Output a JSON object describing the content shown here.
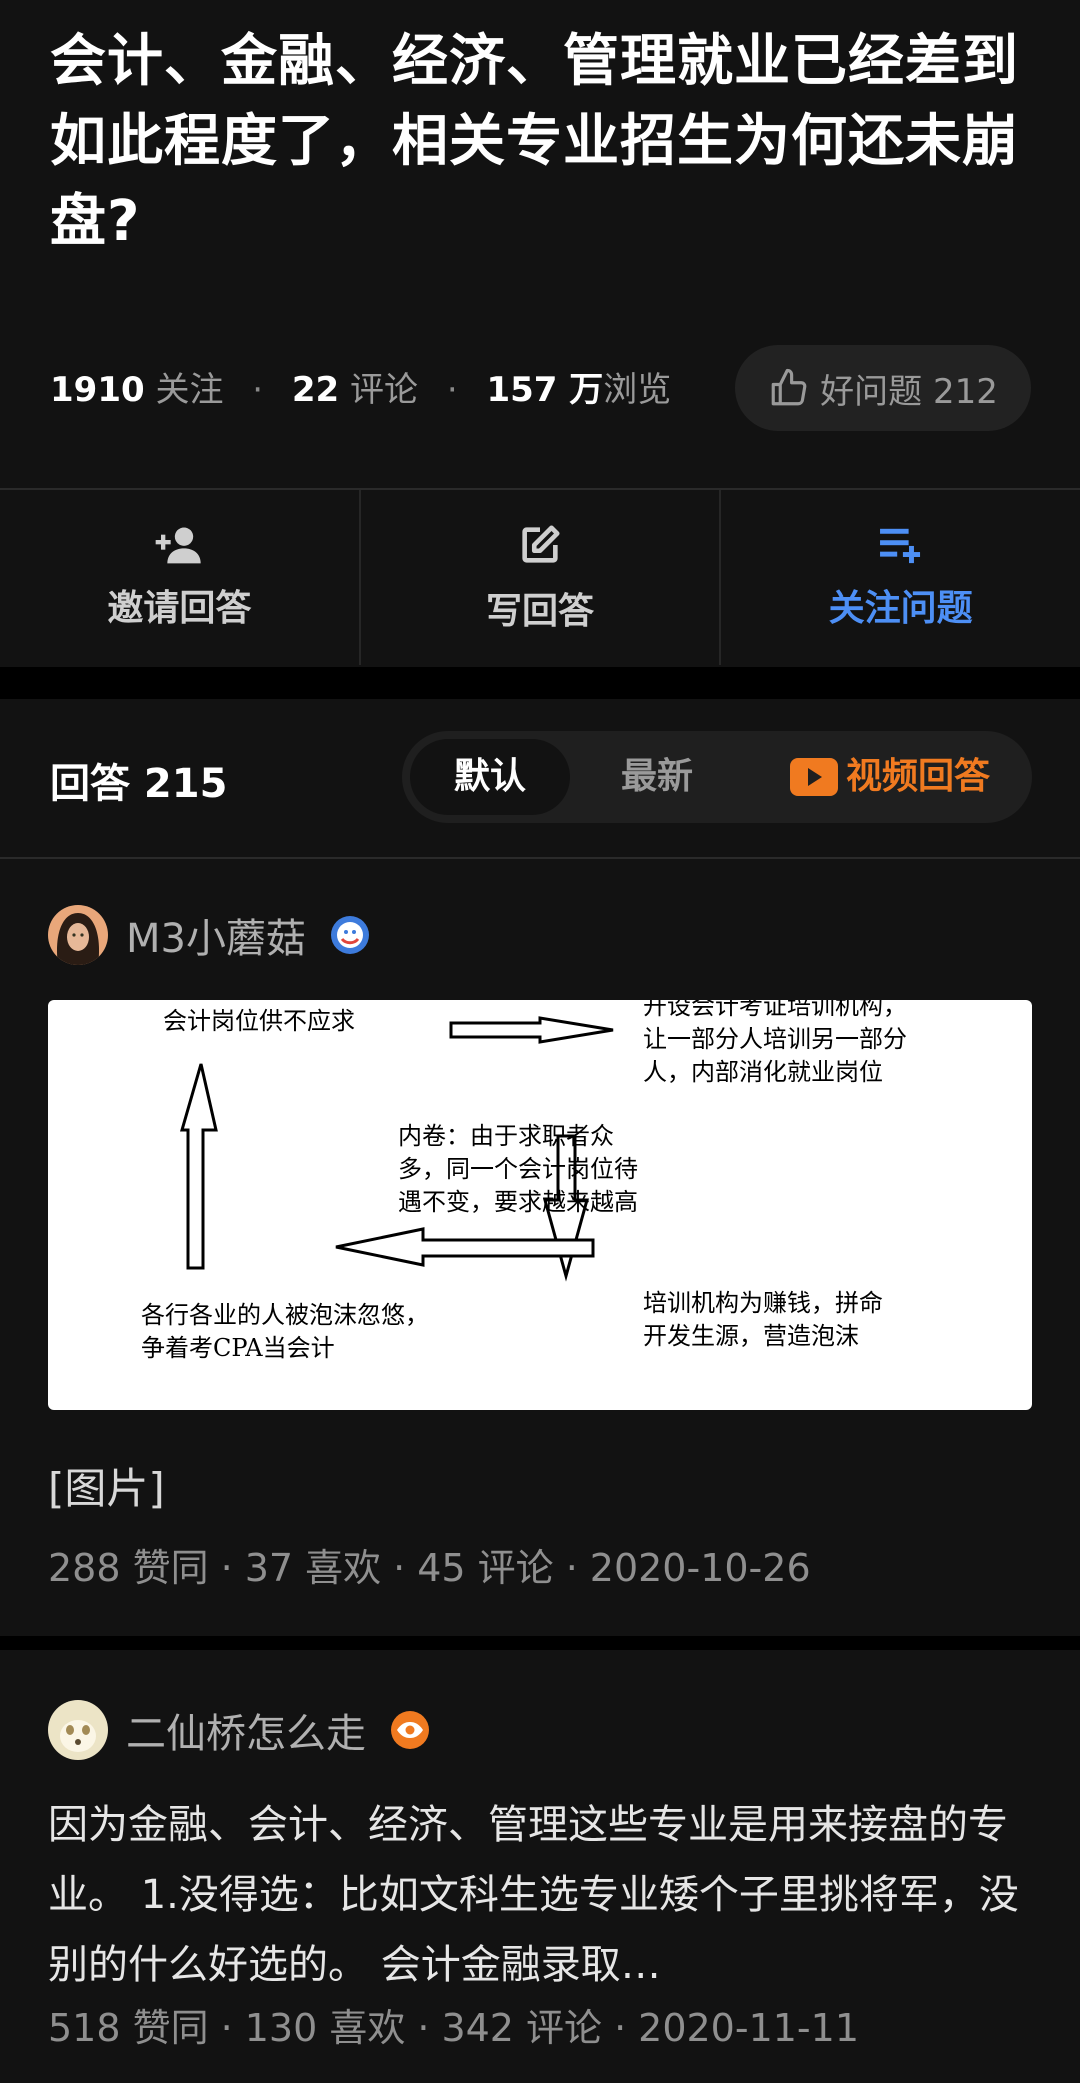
{
  "question": {
    "title": "会计、金融、经济、管理就业已经差到如此程度了，相关专业招生为何还未崩盘?",
    "follow_count": "1910",
    "follow_label": "关注",
    "comment_count": "22",
    "comment_label": "评论",
    "view_count": "157 万",
    "view_label": "浏览",
    "good_question_label": "好问题 212"
  },
  "actions": {
    "invite": "邀请回答",
    "write": "写回答",
    "follow": "关注问题"
  },
  "answers_header": {
    "count_label": "回答 215",
    "tabs": [
      "默认",
      "最新",
      "视频回答"
    ],
    "selected_tab": "默认"
  },
  "answer1": {
    "author": "M3小蘑菇",
    "diagram": {
      "top_left": "会计岗位供不应求",
      "top_right": "开设会计考证培训机构，让一部分人培训另一部分人，内部消化就业岗位",
      "center": "内卷：由于求职者众多，同一个会计岗位待遇不变，要求越来越高",
      "bottom_right": "培训机构为赚钱，拼命开发生源，营造泡沫",
      "bottom_left": "各行各业的人被泡沫忽悠，争着考CPA当会计"
    },
    "image_caption": "[图片]",
    "upvotes": "288 赞同",
    "likes": "37 喜欢",
    "comments": "45 评论",
    "date": "2020-10-26"
  },
  "answer2": {
    "author": "二仙桥怎么走",
    "excerpt": "因为金融、会计、经济、管理这些专业是用来接盘的专业。 1.没得选：比如文科生选专业矮个子里挑将军，没别的什么好选的。 会计金融录取…",
    "upvotes": "518 赞同",
    "likes": "130 喜欢",
    "comments": "342 评论",
    "date": "2020-11-11"
  },
  "colors": {
    "background": "#121212",
    "accent_blue": "#4d8ff5",
    "video_orange": "#f07a20"
  }
}
